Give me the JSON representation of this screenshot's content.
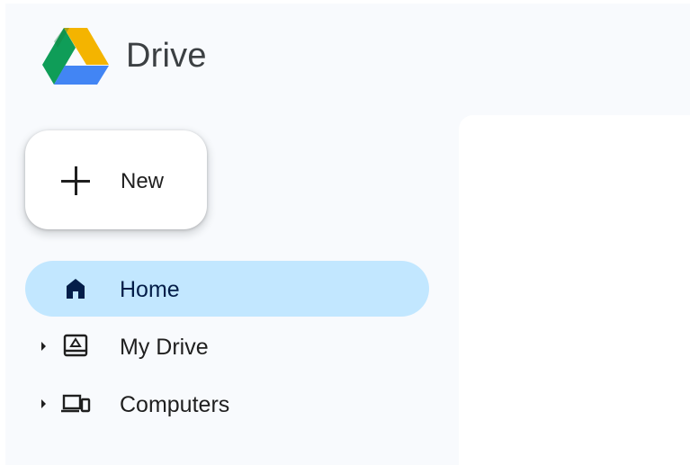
{
  "app": {
    "title": "Drive",
    "logo_icon": "google-drive-logo"
  },
  "new_button": {
    "label": "New",
    "icon": "plus-icon"
  },
  "sidebar": {
    "items": [
      {
        "label": "Home",
        "icon": "home-icon",
        "active": true,
        "expandable": false
      },
      {
        "label": "My Drive",
        "icon": "my-drive-icon",
        "active": false,
        "expandable": true
      },
      {
        "label": "Computers",
        "icon": "computers-icon",
        "active": false,
        "expandable": true
      }
    ]
  },
  "colors": {
    "background": "#f8fafd",
    "active_item": "#c2e7ff",
    "drive_green": "#0f9d58",
    "drive_yellow": "#f4b400",
    "drive_blue": "#4285f4",
    "drive_red": "#db4437"
  }
}
